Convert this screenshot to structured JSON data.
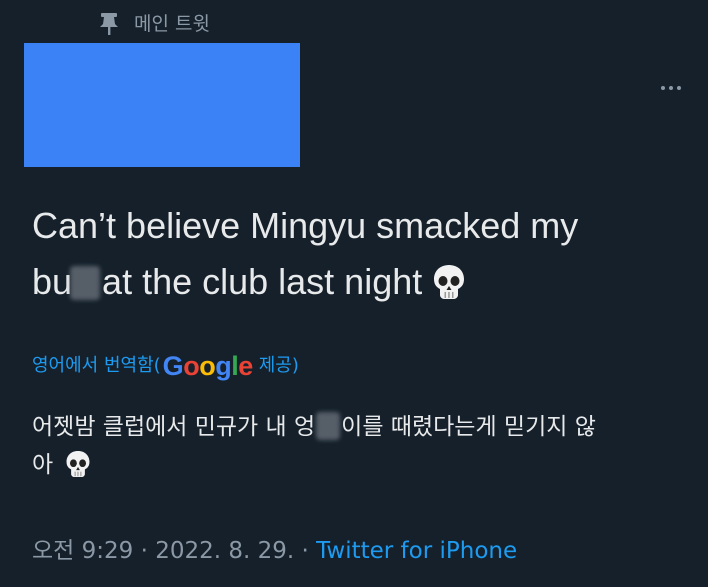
{
  "pinned": {
    "label": "메인 트윗",
    "icon": "pin-icon"
  },
  "author": {
    "redaction_color": "#3b82f6"
  },
  "menu": {
    "icon": "more-icon"
  },
  "tweet": {
    "text_line1": "Can’t believe Mingyu smacked my",
    "text_line2_before": "bu",
    "text_line2_after": "at the club last night",
    "emoji": "skull-emoji"
  },
  "translation": {
    "prefix": "영어에서 번역함(",
    "provider_letters": [
      "G",
      "o",
      "o",
      "g",
      "l",
      "e"
    ],
    "provider_colors": [
      "#4285f4",
      "#ea4335",
      "#fbbc05",
      "#4285f4",
      "#34a853",
      "#ea4335"
    ],
    "suffix": " 제공)",
    "text_line1_before": "어젯밤 클럽에서 민규가 내 엉",
    "text_line1_after": "이를 때렸다는게 믿기지 않",
    "text_line2": "아"
  },
  "meta": {
    "time": "오전 9:29",
    "separator": " · ",
    "date": "2022. 8. 29.",
    "source": "Twitter for iPhone"
  },
  "colors": {
    "background": "#15202b",
    "text_primary": "#e7e9ea",
    "text_secondary": "#8b98a5",
    "accent": "#1d9bf0"
  }
}
